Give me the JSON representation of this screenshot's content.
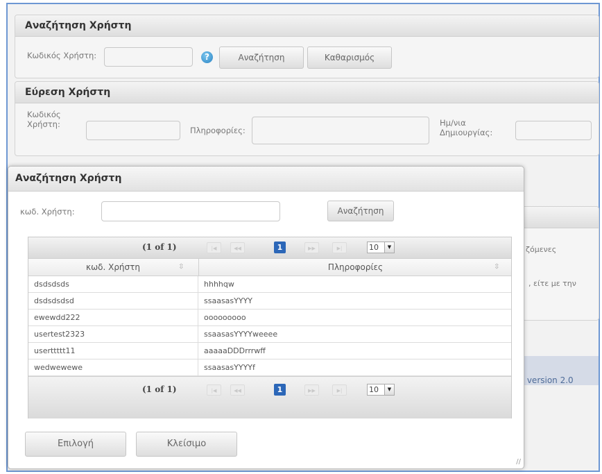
{
  "search_panel": {
    "title": "Αναζήτηση Χρήστη",
    "user_code_label": "Κωδικός Χρήστη:",
    "user_code_value": "",
    "help_icon_glyph": "?",
    "search_button": "Αναζήτηση",
    "clear_button": "Καθαρισμός"
  },
  "found_panel": {
    "title": "Εύρεση Χρήστη",
    "user_code_label_1": "Κωδικός",
    "user_code_label_2": "Χρήστη:",
    "info_label": "Πληροφορίες:",
    "date_label_1": "Ημ/νια",
    "date_label_2": "Δημιουργίας:"
  },
  "background": {
    "partial_text_1": "ζόμενες",
    "partial_text_2": ", είτε με την",
    "version": "version 2.0",
    "accent_color": "#d5dbe7"
  },
  "dialog": {
    "title": "Αναζήτηση Χρήστη",
    "user_code_label": "κωδ. Χρήστη:",
    "user_code_value": "",
    "search_button": "Αναζήτηση",
    "select_button": "Επιλογή",
    "close_button": "Κλείσιμο",
    "paginator": {
      "count": "(1 of 1)",
      "current_page": "1",
      "rows_per_page": "10"
    },
    "table": {
      "columns": [
        "κωδ. Χρήστη",
        "Πληροφορίες"
      ],
      "rows": [
        [
          "dsdsdsds",
          "hhhhqw"
        ],
        [
          "dsdsdsdsd",
          "ssaasasYYYY"
        ],
        [
          "ewewdd222",
          "ooooooooo"
        ],
        [
          "usertest2323",
          "ssaasasYYYYweeee"
        ],
        [
          "userttttt11",
          "aaaaaDDDrrrwff"
        ],
        [
          "wedwewewe",
          "ssaasasYYYYf"
        ]
      ]
    }
  }
}
